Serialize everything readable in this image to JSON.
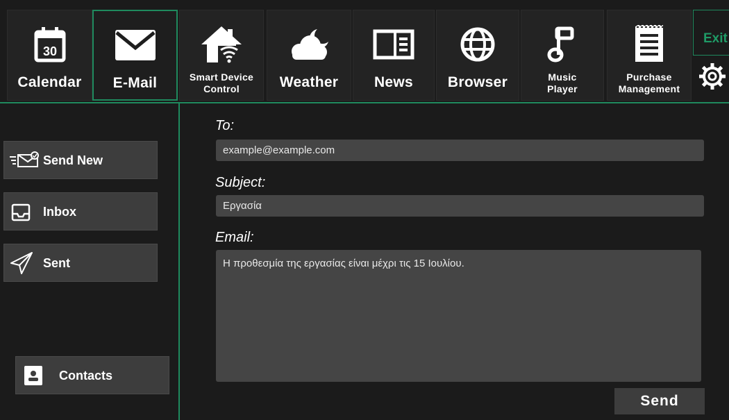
{
  "apps": [
    {
      "label": "Calendar",
      "icon": "calendar-icon",
      "badge": "30"
    },
    {
      "label": "E-Mail",
      "icon": "envelope-icon"
    },
    {
      "label": "Smart Device Control",
      "icon": "smart-home-icon"
    },
    {
      "label": "Weather",
      "icon": "cloud-moon-icon"
    },
    {
      "label": "News",
      "icon": "newspaper-icon"
    },
    {
      "label": "Browser",
      "icon": "globe-icon"
    },
    {
      "label": "Music Player",
      "icon": "music-note-icon"
    },
    {
      "label": "Purchase Management",
      "icon": "receipt-icon"
    }
  ],
  "header": {
    "exit_label": "Exit",
    "settings_icon": "gear-icon"
  },
  "sidebar": {
    "send_new": "Send New",
    "inbox": "Inbox",
    "sent": "Sent",
    "contacts": "Contacts"
  },
  "compose": {
    "to_label": "To:",
    "to_value": "example@example.com",
    "subject_label": "Subject:",
    "subject_value": "Εργασία",
    "email_label": "Email:",
    "email_body": "Η προθεσμία της εργασίας είναι μέχρι τις 15 Ιουλίου.",
    "send_label": "Send"
  },
  "colors": {
    "accent": "#1f8a5e",
    "background": "#1b1b1b",
    "field": "#454545",
    "button": "#3d3d3d"
  }
}
